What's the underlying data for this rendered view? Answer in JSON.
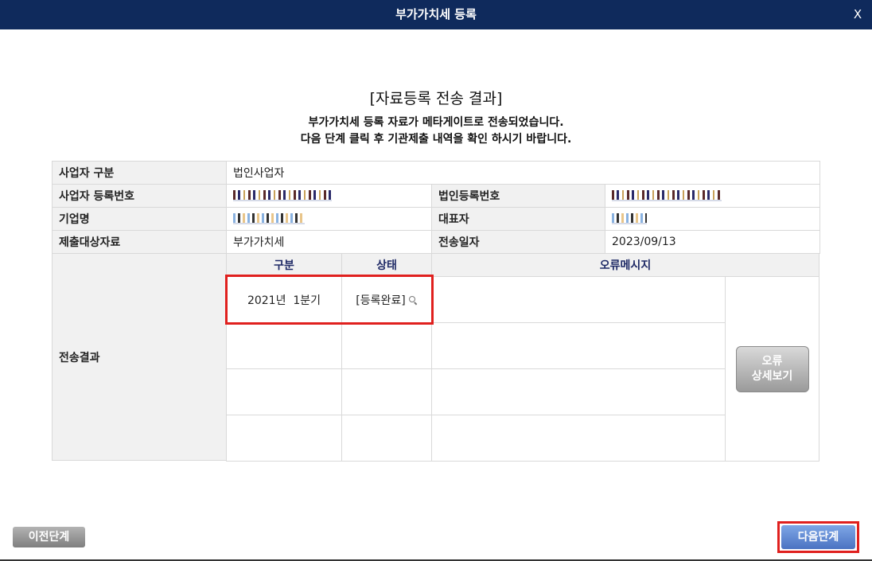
{
  "window": {
    "title": "부가가치세 등록",
    "close_label": "X"
  },
  "heading": "[자료등록 전송 결과]",
  "message": {
    "line1": "부가가치세 등록 자료가 메타게이트로 전송되었습니다.",
    "line2": "다음 단계 클릭 후 기관제출 내역을 확인 하시기 바랍니다."
  },
  "info": {
    "business_type_label": "사업자 구분",
    "business_type_value": "법인사업자",
    "reg_no_label": "사업자 등록번호",
    "corp_reg_no_label": "법인등록번호",
    "company_name_label": "기업명",
    "ceo_label": "대표자",
    "target_label": "제출대상자료",
    "target_value": "부가가치세",
    "sent_date_label": "전송일자",
    "sent_date_value": "2023/09/13",
    "result_label": "전송결과"
  },
  "results": {
    "columns": {
      "period": "구분",
      "status": "상태",
      "error": "오류메시지"
    },
    "rows": [
      {
        "period": "2021년  1분기",
        "status": "[등록완료]",
        "error": ""
      },
      {
        "period": "",
        "status": "",
        "error": ""
      },
      {
        "period": "",
        "status": "",
        "error": ""
      },
      {
        "period": "",
        "status": "",
        "error": ""
      }
    ],
    "error_button_line1": "오류",
    "error_button_line2": "상세보기"
  },
  "footer": {
    "prev_label": "이전단계",
    "next_label": "다음단계"
  },
  "colors": {
    "titlebar": "#0f2a5c",
    "highlight": "#e0201e",
    "next_button": "#5a82d0"
  },
  "icons": {
    "status_search": "magnifier-icon"
  }
}
